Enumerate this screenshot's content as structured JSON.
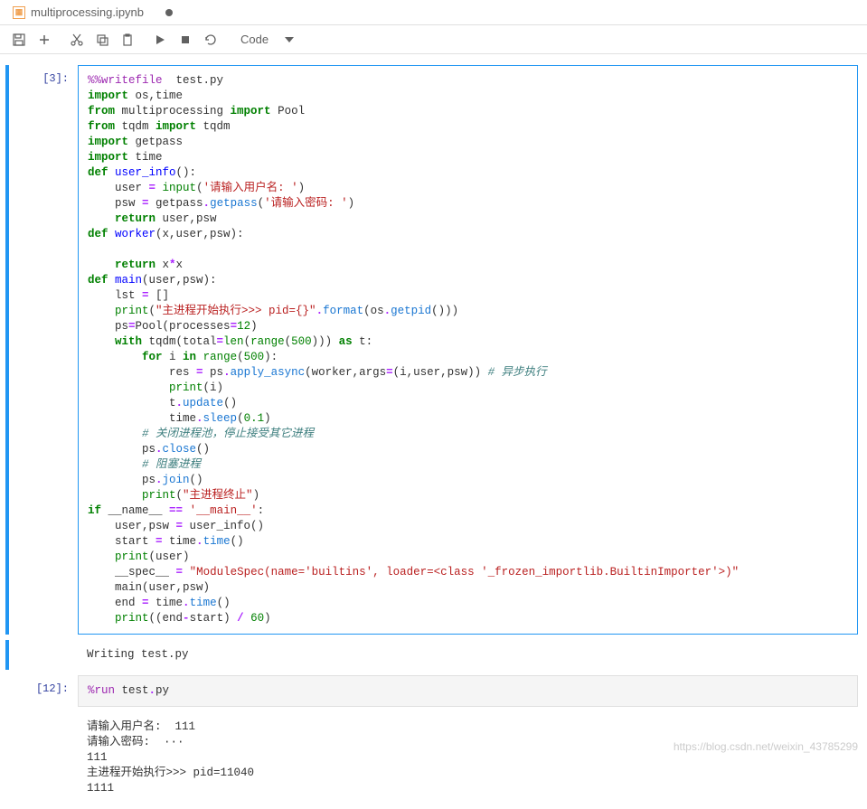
{
  "tab": {
    "filename": "multiprocessing.ipynb",
    "dirty": true
  },
  "toolbar": {
    "cell_type": "Code"
  },
  "cells": [
    {
      "prompt": "[3]:",
      "type": "code",
      "selected": true,
      "output": "Writing test.py"
    },
    {
      "prompt": "[12]:",
      "type": "code",
      "input_plain": "%run test.py",
      "output": "请输入用户名:  111\n请输入密码:  ···\n111\n主进程开始执行>>> pid=11040\n1111"
    }
  ],
  "code_lines": {
    "l0_magic": "%%writefile",
    "l0_rest": "  test.py",
    "l1_kw": "import",
    "l1_mod": " os,time",
    "l2_kw1": "from",
    "l2_mod": " multiprocessing ",
    "l2_kw2": "import",
    "l2_name": " Pool",
    "l3_kw1": "from",
    "l3_mod": " tqdm ",
    "l3_kw2": "import",
    "l3_name": " tqdm",
    "l4_kw": "import",
    "l4_mod": " getpass",
    "l5_kw": "import",
    "l5_mod": " time",
    "l6_kw": "def",
    "l6_fn": " user_info",
    "l6_rest": "():",
    "l7_pre": "    user ",
    "l7_op": "=",
    "l7_sp": " ",
    "l7_bn": "input",
    "l7_paren": "(",
    "l7_str": "'请输入用户名: '",
    "l7_end": ")",
    "l8_pre": "    psw ",
    "l8_op": "=",
    "l8_mid": " getpass",
    "l8_dot": ".",
    "l8_cl": "getpass",
    "l8_paren": "(",
    "l8_str": "'请输入密码: '",
    "l8_end": ")",
    "l9_kw": "    return",
    "l9_rest": " user,psw",
    "l10_kw": "def",
    "l10_fn": " worker",
    "l10_rest": "(x,user,psw):",
    "l11": "",
    "l12_kw": "    return",
    "l12_rest": " x",
    "l12_op": "*",
    "l12_rest2": "x",
    "l13_kw": "def",
    "l13_fn": " main",
    "l13_rest": "(user,psw):",
    "l14_pre": "    lst ",
    "l14_op": "=",
    "l14_rest": " []",
    "l15_pre": "    ",
    "l15_bn": "print",
    "l15_paren": "(",
    "l15_str": "\"主进程开始执行>>> pid={}\"",
    "l15_dot": ".",
    "l15_cl": "format",
    "l15_mid": "(os",
    "l15_dot2": ".",
    "l15_cl2": "getpid",
    "l15_end": "()))",
    "l16_pre": "    ps",
    "l16_op": "=",
    "l16_name": "Pool(processes",
    "l16_op2": "=",
    "l16_nb": "12",
    "l16_end": ")",
    "l17_kw": "    with",
    "l17_mid": " tqdm(total",
    "l17_op": "=",
    "l17_bn": "len",
    "l17_paren": "(",
    "l17_bn2": "range",
    "l17_paren2": "(",
    "l17_nb": "500",
    "l17_close": "))) ",
    "l17_kw2": "as",
    "l17_rest": " t:",
    "l18_kw": "        for",
    "l18_mid": " i ",
    "l18_kw2": "in",
    "l18_sp": " ",
    "l18_bn": "range",
    "l18_paren": "(",
    "l18_nb": "500",
    "l18_end": "):",
    "l19_pre": "            res ",
    "l19_op": "=",
    "l19_mid": " ps",
    "l19_dot": ".",
    "l19_cl": "apply_async",
    "l19_mid2": "(worker,args",
    "l19_op2": "=",
    "l19_rest": "(i,user,psw)) ",
    "l19_cm": "# 异步执行",
    "l20_pre": "            ",
    "l20_bn": "print",
    "l20_rest": "(i)",
    "l21_pre": "            t",
    "l21_dot": ".",
    "l21_cl": "update",
    "l21_end": "()",
    "l22_pre": "            time",
    "l22_dot": ".",
    "l22_cl": "sleep",
    "l22_paren": "(",
    "l22_nb": "0.1",
    "l22_end": ")",
    "l23_cm": "        # 关闭进程池，停止接受其它进程",
    "l24_pre": "        ps",
    "l24_dot": ".",
    "l24_cl": "close",
    "l24_end": "()",
    "l25_cm": "        # 阻塞进程",
    "l26_pre": "        ps",
    "l26_dot": ".",
    "l26_cl": "join",
    "l26_end": "()",
    "l27_pre": "        ",
    "l27_bn": "print",
    "l27_paren": "(",
    "l27_str": "\"主进程终止\"",
    "l27_end": ")",
    "l28_kw": "if",
    "l28_mid": " __name__ ",
    "l28_op": "==",
    "l28_sp": " ",
    "l28_str": "'__main__'",
    "l28_end": ":",
    "l29_pre": "    user,psw ",
    "l29_op": "=",
    "l29_rest": " user_info()",
    "l30_pre": "    start ",
    "l30_op": "=",
    "l30_mid": " time",
    "l30_dot": ".",
    "l30_cl": "time",
    "l30_end": "()",
    "l31_pre": "    ",
    "l31_bn": "print",
    "l31_rest": "(user)",
    "l32_pre": "    __spec__ ",
    "l32_op": "=",
    "l32_sp": " ",
    "l32_str": "\"ModuleSpec(name='builtins', loader=<class '_frozen_importlib.BuiltinImporter'>)\"",
    "l33": "    main(user,psw)",
    "l34_pre": "    end ",
    "l34_op": "=",
    "l34_mid": " time",
    "l34_dot": ".",
    "l34_cl": "time",
    "l34_end": "()",
    "l35_pre": "    ",
    "l35_bn": "print",
    "l35_mid": "((end",
    "l35_op": "-",
    "l35_mid2": "start) ",
    "l35_op2": "/",
    "l35_sp": " ",
    "l35_nb": "60",
    "l35_end": ")"
  },
  "watermark": "https://blog.csdn.net/weixin_43785299"
}
